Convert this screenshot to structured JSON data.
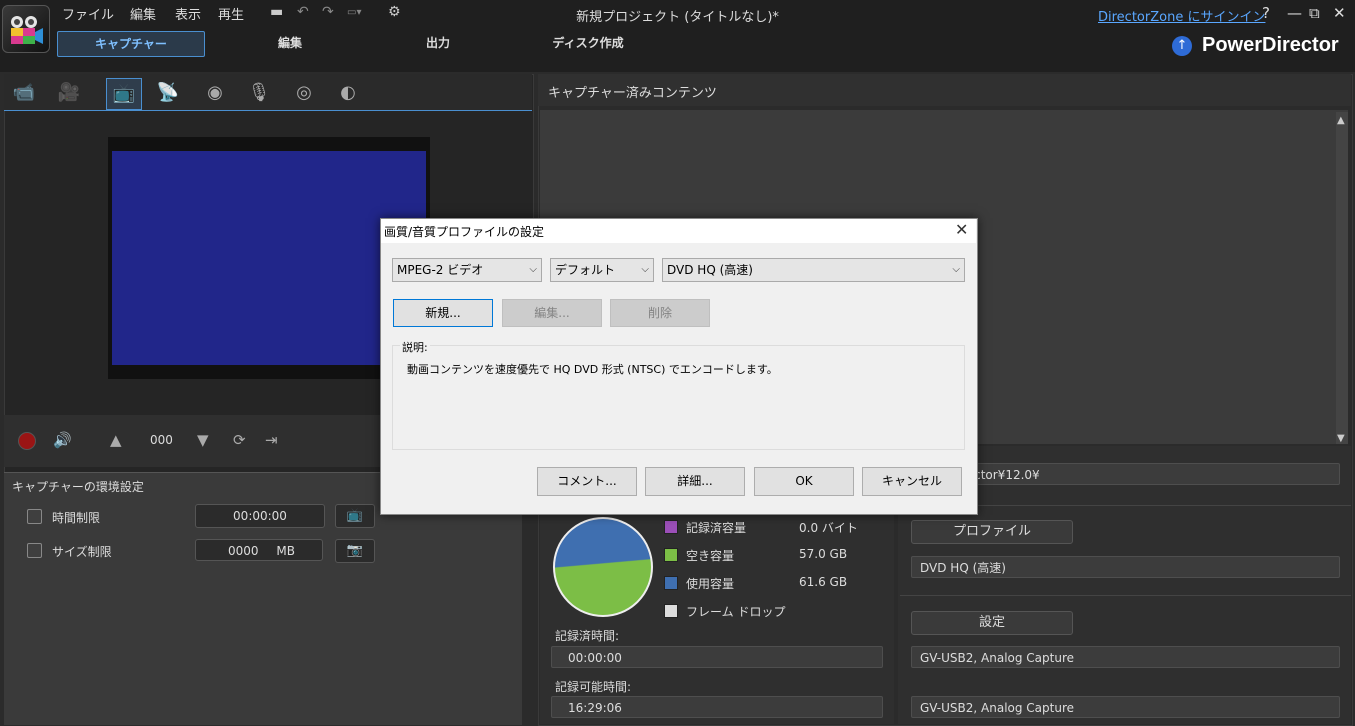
{
  "menu": {
    "items": [
      "ファイル",
      "編集",
      "表示",
      "再生"
    ]
  },
  "window": {
    "title": "新規プロジェクト (タイトルなし)*",
    "directorzone_link": "DirectorZone にサインイン",
    "help": "?",
    "minimize": "—",
    "maximize": "⧉",
    "close": "✕"
  },
  "modes": {
    "capture": "キャプチャー",
    "edit": "編集",
    "output": "出力",
    "disc": "ディスク作成"
  },
  "brand": {
    "name": "PowerDirector",
    "accent": "#2e6bd6"
  },
  "capture_icons": [
    "camcorder-icon",
    "hdv-camera-icon",
    "tv-icon",
    "digital-tv-icon",
    "webcam-icon",
    "microphone-icon",
    "cd-icon",
    "dvd-icon"
  ],
  "transport": {
    "counter": "000"
  },
  "capture_settings": {
    "title": "キャプチャーの環境設定",
    "time_limit_label": "時間制限",
    "time_limit_value": "00:00:00",
    "size_limit_label": "サイズ制限",
    "size_limit_value": "0000",
    "size_limit_unit": "MB"
  },
  "captured": {
    "title": "キャプチャー済みコンテンツ"
  },
  "disk": {
    "legend": [
      {
        "label": "記録済容量",
        "value": "0.0",
        "unit": "バイト",
        "color": "#9b4fb8"
      },
      {
        "label": "空き容量",
        "value": "57.0",
        "unit": "GB",
        "color": "#7cbe46"
      },
      {
        "label": "使用容量",
        "value": "61.6",
        "unit": "GB",
        "color": "#3f6fb0"
      },
      {
        "label": "フレーム ドロップ",
        "value": "",
        "unit": "",
        "color": "#dddddd"
      }
    ],
    "recorded_time_label": "記録済時間:",
    "recorded_time_value": "00:00:00",
    "available_time_label": "記録可能時間:",
    "available_time_value": "16:29:06"
  },
  "right_settings": {
    "folder": "owerDirector¥12.0¥",
    "profile_button": "プロファイル",
    "profile_value": "DVD HQ (高速)",
    "settings_button": "設定",
    "device_video": "GV-USB2, Analog Capture",
    "device_audio": "GV-USB2, Analog Capture"
  },
  "dialog": {
    "title": "画質/音質プロファイルの設定",
    "format": "MPEG-2 ビデオ",
    "preset": "デフォルト",
    "profile": "DVD HQ (高速)",
    "new_button": "新規...",
    "edit_button": "編集...",
    "delete_button": "削除",
    "desc_label": "説明:",
    "desc_text": "動画コンテンツを速度優先で HQ DVD 形式 (NTSC) でエンコードします。",
    "comment_button": "コメント...",
    "details_button": "詳細...",
    "ok_button": "OK",
    "cancel_button": "キャンセル"
  }
}
